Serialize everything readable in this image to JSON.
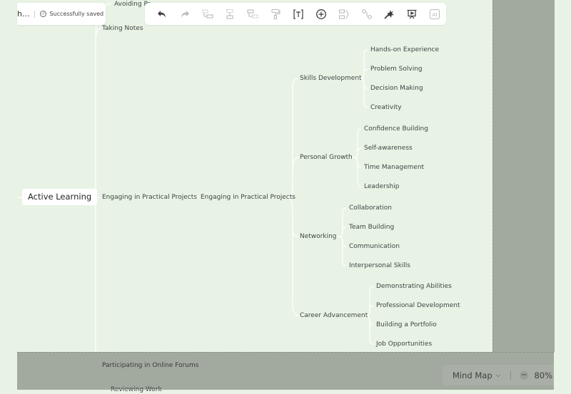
{
  "header": {
    "doc_title_truncated": "h...",
    "save_status": "Successfully saved",
    "save_status_icon": "check-circle-icon"
  },
  "toolbar": {
    "buttons": [
      {
        "name": "undo",
        "icon": "undo-icon",
        "enabled": true
      },
      {
        "name": "redo",
        "icon": "redo-icon",
        "enabled": false
      },
      {
        "name": "insert-child-topic",
        "icon": "child-topic-icon",
        "enabled": false
      },
      {
        "name": "insert-sibling-topic",
        "icon": "sibling-topic-icon",
        "enabled": false
      },
      {
        "name": "insert-parent-topic",
        "icon": "parent-topic-icon",
        "enabled": false
      },
      {
        "name": "format-painter",
        "icon": "paint-roller-icon",
        "enabled": false
      },
      {
        "name": "text",
        "icon": "text-box-icon",
        "enabled": true
      },
      {
        "name": "insert",
        "icon": "plus-circle-icon",
        "enabled": true
      },
      {
        "name": "summary",
        "icon": "summary-icon",
        "enabled": false
      },
      {
        "name": "relationship",
        "icon": "relationship-icon",
        "enabled": false
      },
      {
        "name": "magic",
        "icon": "magic-wand-icon",
        "enabled": true
      },
      {
        "name": "presentation",
        "icon": "presentation-icon",
        "enabled": true
      },
      {
        "name": "ai",
        "icon": "ai-icon",
        "label": "AI",
        "enabled": false
      }
    ]
  },
  "mindmap": {
    "root": "Active Learning",
    "level1": [
      {
        "label": "Avoiding Procrastination",
        "visible_text": "Avoiding Pr"
      },
      {
        "label": "Taking Notes"
      },
      {
        "label": "Engaging in Practical Projects"
      },
      {
        "label": "Participating in Online Forums"
      },
      {
        "label": "Reviewing Work",
        "visible_text": "Reviewing Work"
      }
    ],
    "level2": {
      "label": "Engaging in Practical Projects"
    },
    "level3": [
      {
        "label": "Skills Development",
        "children": [
          "Hands-on Experience",
          "Problem Solving",
          "Decision Making",
          "Creativity"
        ]
      },
      {
        "label": "Personal Growth",
        "children": [
          "Confidence Building",
          "Self-awareness",
          "Time Management",
          "Leadership"
        ]
      },
      {
        "label": "Networking",
        "children": [
          "Collaboration",
          "Team Building",
          "Communication",
          "Interpersonal Skills"
        ]
      },
      {
        "label": "Career Advancement",
        "children": [
          "Demonstrating Abilities",
          "Professional Development",
          "Building a Portfolio",
          "Job Opportunities"
        ]
      }
    ]
  },
  "bottom_bar": {
    "view_mode": "Mind Map",
    "zoom_level": "80%"
  },
  "colors": {
    "canvas": "#e8f3e6",
    "overlay": "#a2a99f",
    "branch_line": "#ffffff",
    "text": "#3f4640"
  }
}
